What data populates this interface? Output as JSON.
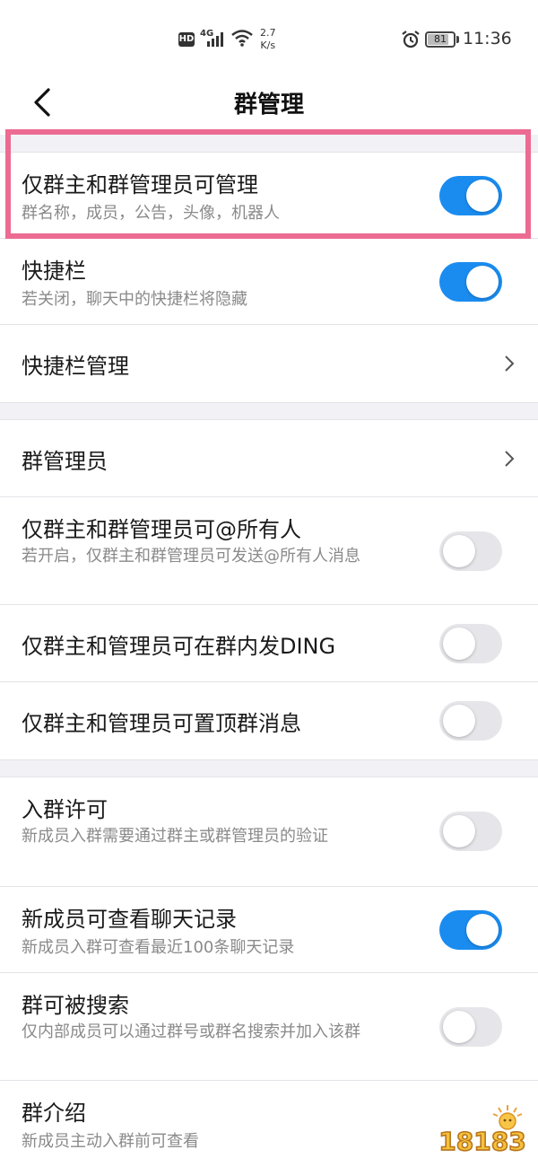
{
  "status_bar": {
    "hd": "HD",
    "network": "4G",
    "speed_value": "2.7",
    "speed_unit": "K/s",
    "battery": "81",
    "battery_level": 0.81,
    "time": "11:36"
  },
  "header": {
    "title": "群管理"
  },
  "sections": [
    {
      "rows": [
        {
          "title": "仅群主和群管理员可管理",
          "subtitle": "群名称，成员，公告，头像，机器人",
          "toggle": true
        },
        {
          "title": "快捷栏",
          "subtitle": "若关闭，聊天中的快捷栏将隐藏",
          "toggle": true
        },
        {
          "title": "快捷栏管理"
        }
      ]
    },
    {
      "rows": [
        {
          "title": "群管理员"
        },
        {
          "title": "仅群主和群管理员可@所有人",
          "subtitle": "若开启，仅群主和群管理员可发送@所有人消息",
          "toggle": false
        },
        {
          "title": "仅群主和管理员可在群内发DING",
          "toggle": false
        },
        {
          "title": "仅群主和管理员可置顶群消息",
          "toggle": false
        }
      ]
    },
    {
      "rows": [
        {
          "title": "入群许可",
          "subtitle": "新成员入群需要通过群主或群管理员的验证",
          "toggle": false
        },
        {
          "title": "新成员可查看聊天记录",
          "subtitle": "新成员入群可查看最近100条聊天记录",
          "toggle": true
        },
        {
          "title": "群可被搜索",
          "subtitle": "仅内部成员可以通过群号或群名搜索并加入该群",
          "toggle": false
        },
        {
          "title": "群介绍",
          "subtitle": "新成员主动入群前可查看"
        }
      ]
    }
  ],
  "watermark": {
    "text": "18183"
  },
  "colors": {
    "accent": "#1a8cf0",
    "highlight": "#ec6b92",
    "section_gap": "#f2f2f6"
  }
}
